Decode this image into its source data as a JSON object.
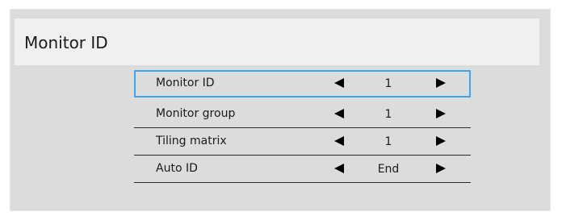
{
  "screen": {
    "title": "Monitor ID"
  },
  "menu": {
    "items": [
      {
        "label": "Monitor ID",
        "value": "1",
        "selected": true
      },
      {
        "label": "Monitor group",
        "value": "1",
        "selected": false
      },
      {
        "label": "Tiling matrix",
        "value": "1",
        "selected": false
      },
      {
        "label": "Auto ID",
        "value": "End",
        "selected": false
      }
    ]
  },
  "icons": {
    "decrease": "left-arrow-icon",
    "increase": "right-arrow-icon"
  },
  "colors": {
    "background": "#dcdcdc",
    "header_background": "#f0f0f0",
    "selection_border": "#3ca6e6",
    "text": "#1a1a1a"
  }
}
